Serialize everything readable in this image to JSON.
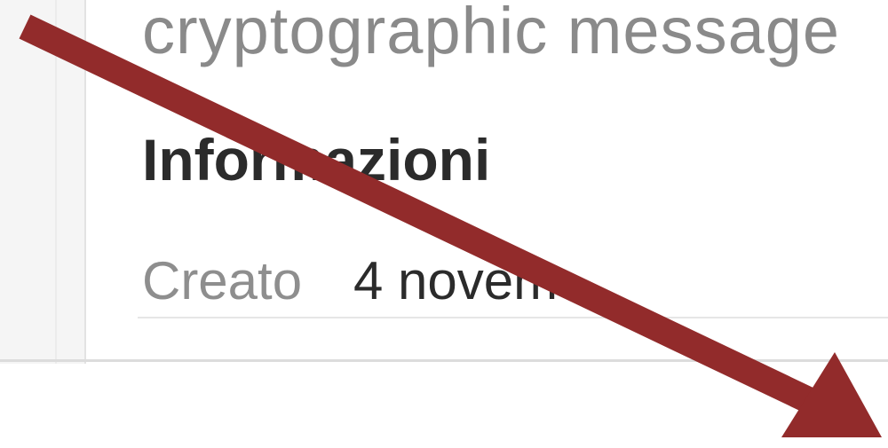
{
  "panel": {
    "description_text": "cryptographic message",
    "section_title": "Informazioni",
    "info_rows": [
      {
        "label": "Creato",
        "value": "4 novem"
      }
    ]
  },
  "annotation": {
    "arrow_color": "#922b2b"
  }
}
